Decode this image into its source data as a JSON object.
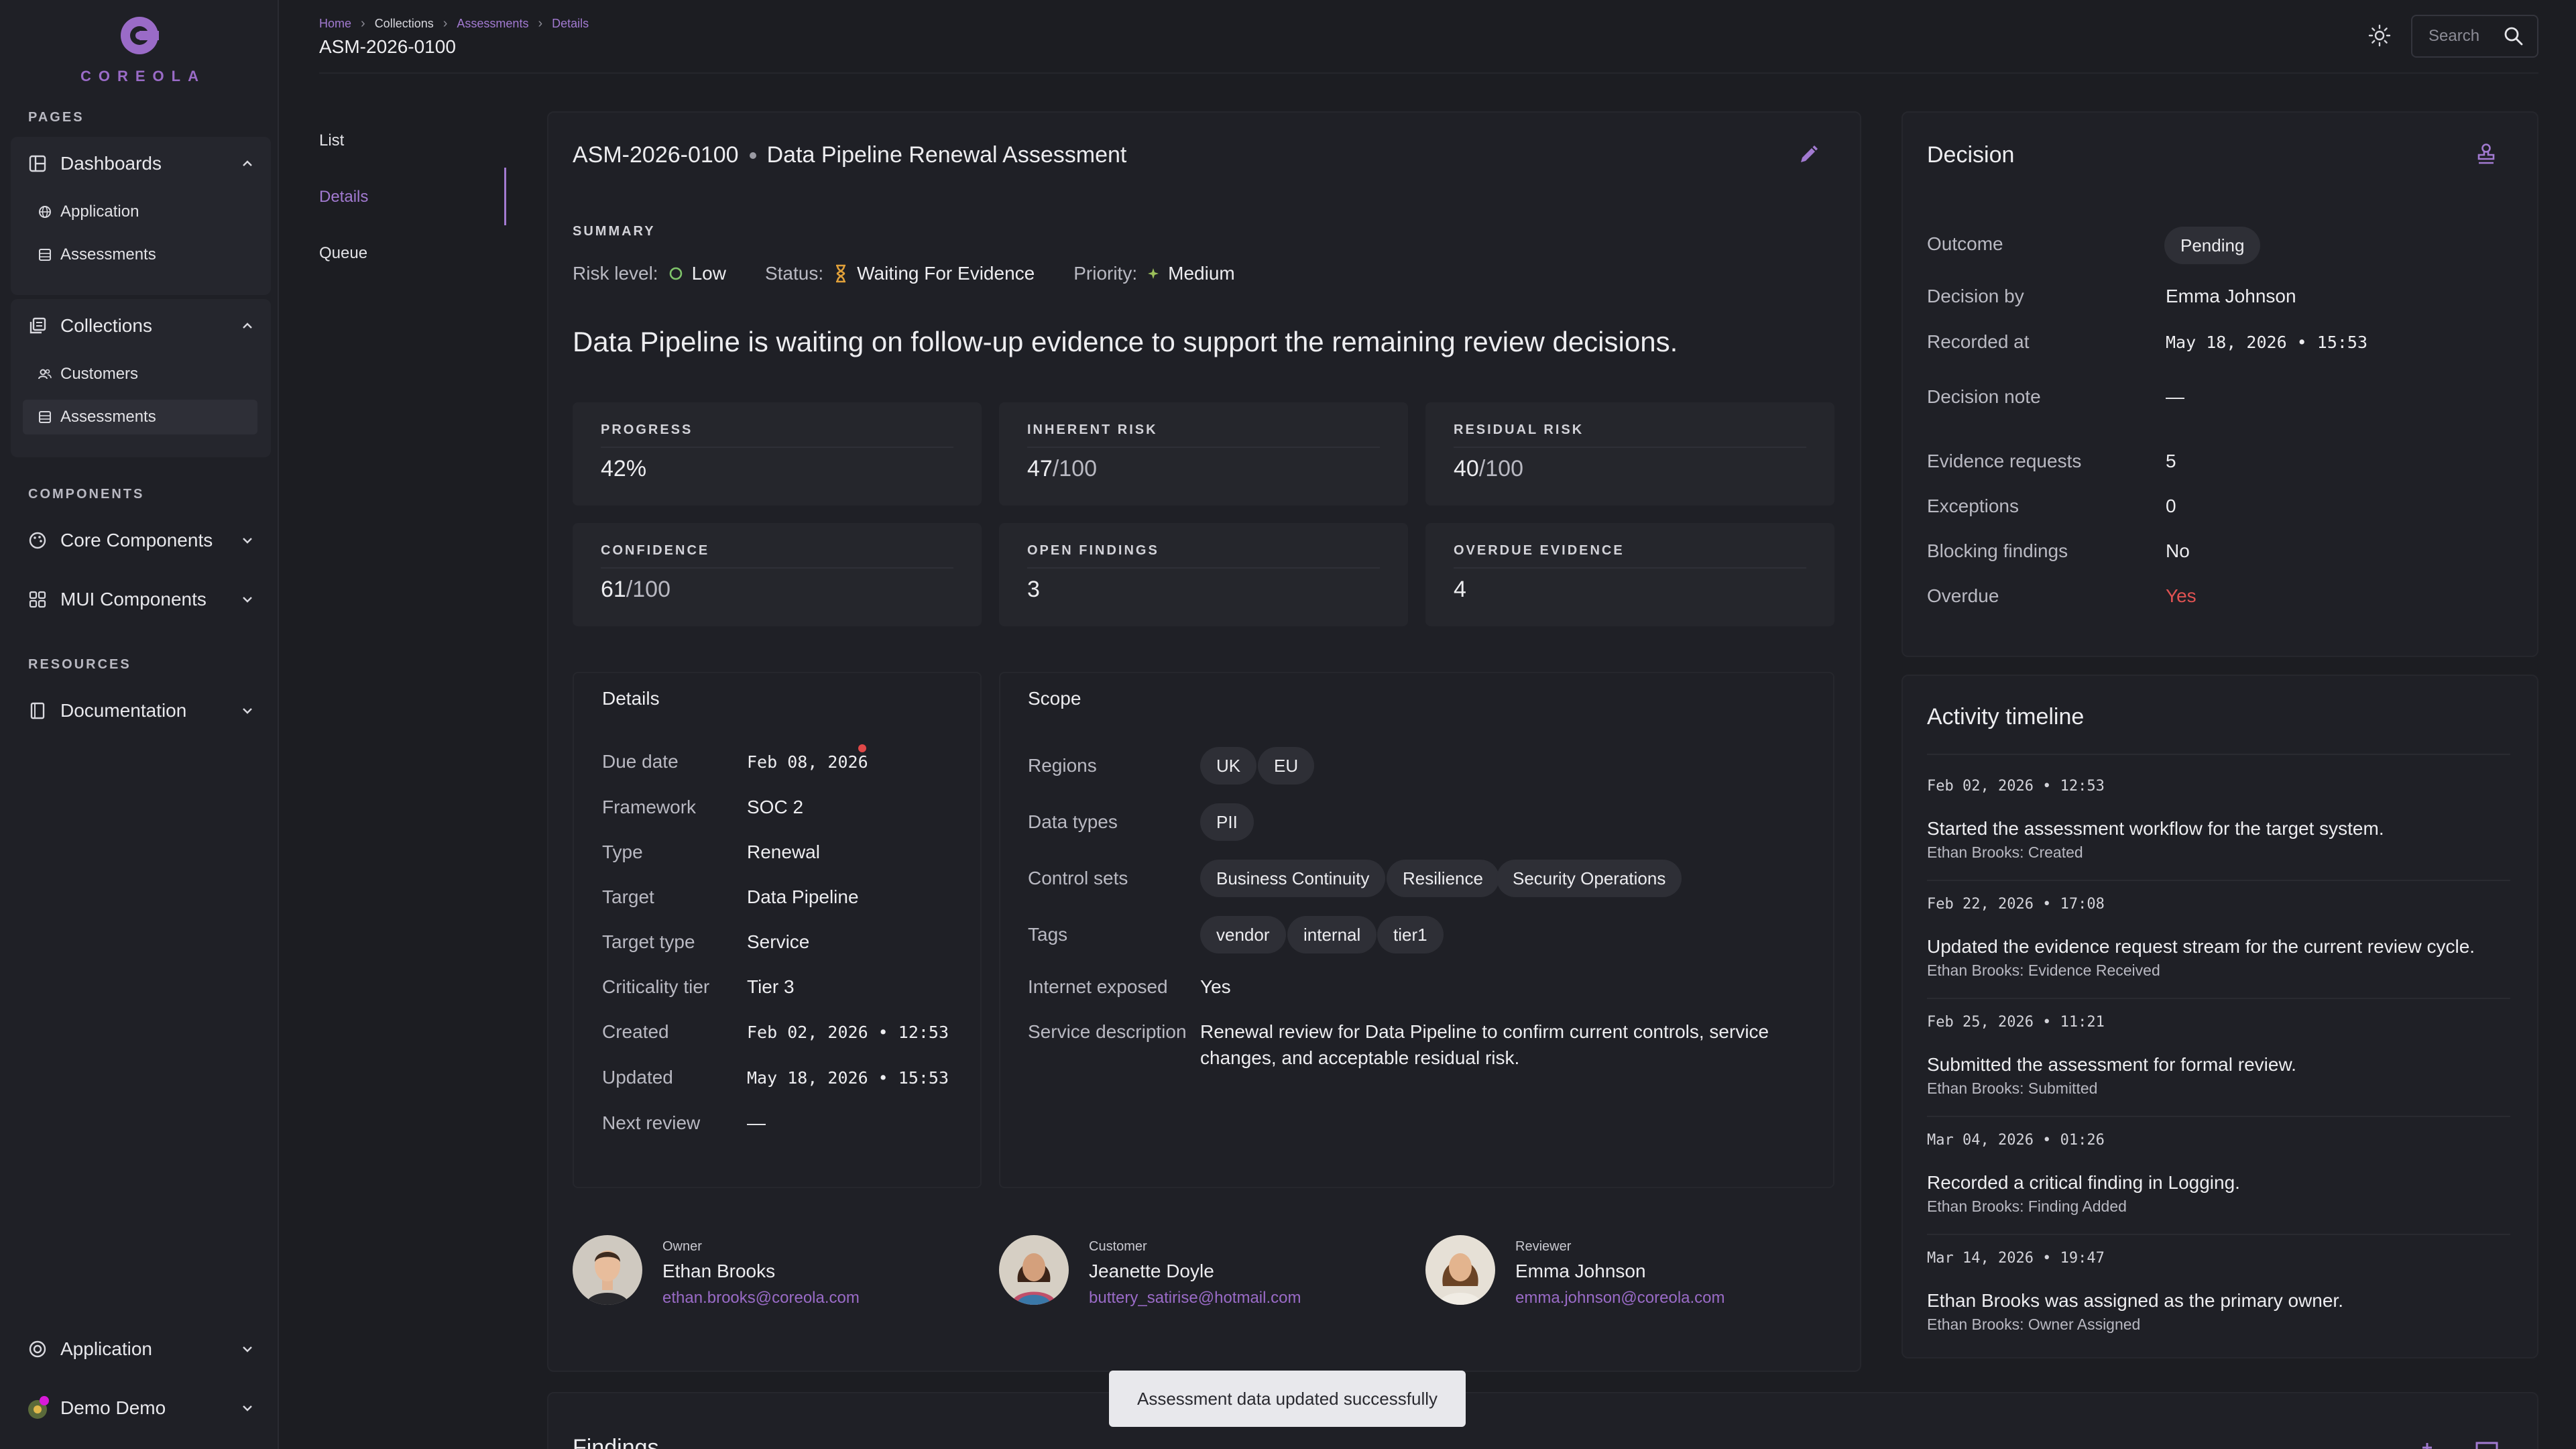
{
  "brand": {
    "name": "COREOLA",
    "accent": "#9a6bc7"
  },
  "sidebar": {
    "pages_label": "PAGES",
    "components_label": "COMPONENTS",
    "resources_label": "RESOURCES",
    "dashboards": {
      "label": "Dashboards",
      "items": [
        "Application",
        "Assessments"
      ]
    },
    "collections": {
      "label": "Collections",
      "items": [
        "Customers",
        "Assessments"
      ]
    },
    "core_components": "Core Components",
    "mui_components": "MUI Components",
    "documentation": "Documentation",
    "application": "Application",
    "user": "Demo Demo"
  },
  "header": {
    "breadcrumb": [
      "Home",
      "Collections",
      "Assessments",
      "Details"
    ],
    "title": "ASM-2026-0100",
    "search_placeholder": "Search"
  },
  "subnav": [
    "List",
    "Details",
    "Queue"
  ],
  "assessment": {
    "id": "ASM-2026-0100",
    "name": "Data Pipeline Renewal Assessment",
    "summary_label": "SUMMARY",
    "risk_level_label": "Risk level:",
    "risk_level": "Low",
    "status_label": "Status:",
    "status": "Waiting For Evidence",
    "priority_label": "Priority:",
    "priority": "Medium",
    "headline": "Data Pipeline is waiting on follow-up evidence to support the remaining review decisions."
  },
  "stats": [
    {
      "label": "PROGRESS",
      "value": "42%",
      "den": ""
    },
    {
      "label": "INHERENT RISK",
      "value": "47",
      "den": "/100"
    },
    {
      "label": "RESIDUAL RISK",
      "value": "40",
      "den": "/100"
    },
    {
      "label": "CONFIDENCE",
      "value": "61",
      "den": "/100"
    },
    {
      "label": "OPEN FINDINGS",
      "value": "3",
      "den": ""
    },
    {
      "label": "OVERDUE EVIDENCE",
      "value": "4",
      "den": ""
    }
  ],
  "details": {
    "title": "Details",
    "rows": [
      {
        "k": "Due date",
        "v": "Feb 08, 2026"
      },
      {
        "k": "Framework",
        "v": "SOC 2"
      },
      {
        "k": "Type",
        "v": "Renewal"
      },
      {
        "k": "Target",
        "v": "Data Pipeline"
      },
      {
        "k": "Target type",
        "v": "Service"
      },
      {
        "k": "Criticality tier",
        "v": "Tier 3"
      },
      {
        "k": "Created",
        "v": "Feb 02, 2026 • 12:53"
      },
      {
        "k": "Updated",
        "v": "May 18, 2026 • 15:53"
      },
      {
        "k": "Next review",
        "v": "—"
      }
    ]
  },
  "scope": {
    "title": "Scope",
    "regions_label": "Regions",
    "regions": [
      "UK",
      "EU"
    ],
    "data_types_label": "Data types",
    "data_types": [
      "PII"
    ],
    "control_sets_label": "Control sets",
    "control_sets": [
      "Business Continuity",
      "Resilience",
      "Security Operations"
    ],
    "tags_label": "Tags",
    "tags": [
      "vendor",
      "internal",
      "tier1"
    ],
    "internet_label": "Internet exposed",
    "internet": "Yes",
    "service_desc_label": "Service description",
    "service_desc_1": "Renewal review for Data Pipeline to confirm current controls, service",
    "service_desc_2": "changes, and acceptable residual risk."
  },
  "people": [
    {
      "role": "Owner",
      "name": "Ethan Brooks",
      "email": "ethan.brooks@coreola.com"
    },
    {
      "role": "Customer",
      "name": "Jeanette Doyle",
      "email": "buttery_satirise@hotmail.com"
    },
    {
      "role": "Reviewer",
      "name": "Emma Johnson",
      "email": "emma.johnson@coreola.com"
    }
  ],
  "decision": {
    "title": "Decision",
    "rows": [
      {
        "k": "Outcome",
        "v": "Pending"
      },
      {
        "k": "Decision by",
        "v": "Emma Johnson"
      },
      {
        "k": "Recorded at",
        "v": "May 18, 2026 • 15:53"
      },
      {
        "k": "Decision note",
        "v": "—"
      },
      {
        "k": "Evidence requests",
        "v": "5"
      },
      {
        "k": "Exceptions",
        "v": "0"
      },
      {
        "k": "Blocking findings",
        "v": "No"
      },
      {
        "k": "Overdue",
        "v": "Yes"
      }
    ]
  },
  "timeline": {
    "title": "Activity timeline",
    "items": [
      {
        "date": "Feb 02, 2026 • 12:53",
        "text": "Started the assessment workflow for the target system.",
        "by": "Ethan Brooks: Created"
      },
      {
        "date": "Feb 22, 2026 • 17:08",
        "text": "Updated the evidence request stream for the current review cycle.",
        "by": "Ethan Brooks: Evidence Received"
      },
      {
        "date": "Feb 25, 2026 • 11:21",
        "text": "Submitted the assessment for formal review.",
        "by": "Ethan Brooks: Submitted"
      },
      {
        "date": "Mar 04, 2026 • 01:26",
        "text": "Recorded a critical finding in Logging.",
        "by": "Ethan Brooks: Finding Added"
      },
      {
        "date": "Mar 14, 2026 • 19:47",
        "text": "Ethan Brooks was assigned as the primary owner.",
        "by": "Ethan Brooks: Owner Assigned"
      }
    ]
  },
  "toast": "Assessment data updated successfully",
  "findings_title": "Findings"
}
